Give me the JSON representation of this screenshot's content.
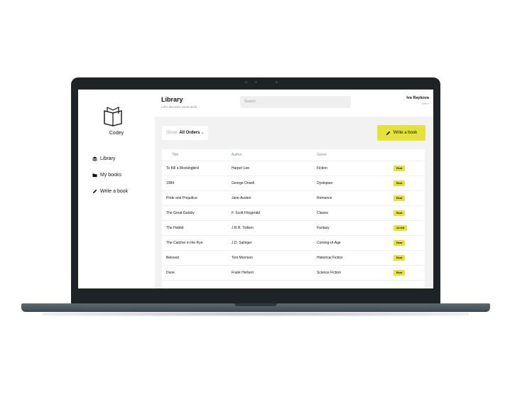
{
  "app": {
    "name": "Codey"
  },
  "sidebar": {
    "items": [
      {
        "label": "Library",
        "icon": "layers-icon"
      },
      {
        "label": "My books",
        "icon": "folder-icon"
      },
      {
        "label": "Write a book",
        "icon": "pencil-icon"
      }
    ]
  },
  "header": {
    "title": "Library",
    "subtitle": "Let's discover some work",
    "search_placeholder": "Search",
    "user_name": "Iva Raykova",
    "user_role": "Writer"
  },
  "toolbar": {
    "filter_label": "Show:",
    "filter_value": "All Orders",
    "write_button": "Write a book"
  },
  "table": {
    "columns": [
      "Title",
      "Author",
      "Genre"
    ],
    "rows": [
      {
        "title": "To Kill a Mockingbird",
        "author": "Harper Lee",
        "genre": "Fiction",
        "status": "Rent"
      },
      {
        "title": "1984",
        "author": "George Orwell",
        "genre": "Dystopian",
        "status": "Rent"
      },
      {
        "title": "Pride and Prejudice",
        "author": "Jane Austen",
        "genre": "Romance",
        "status": "Rent"
      },
      {
        "title": "The Great Gatsby",
        "author": "F. Scott Fitzgerald",
        "genre": "Classic",
        "status": "Rent"
      },
      {
        "title": "The Hobbit",
        "author": "J.R.R. Tolkien",
        "genre": "Fantasy",
        "status": "1d left"
      },
      {
        "title": "The Catcher in the Rye",
        "author": "J.D. Salinger",
        "genre": "Coming-of-Age",
        "status": "Rent"
      },
      {
        "title": "Beloved",
        "author": "Toni Morrison",
        "genre": "Historical Fiction",
        "status": "Rent"
      },
      {
        "title": "Dune",
        "author": "Frank Herbert",
        "genre": "Science Fiction",
        "status": "Rent"
      }
    ]
  },
  "colors": {
    "accent": "#e3e33c",
    "lid": "#1e2326",
    "base": "#4b5b62"
  }
}
